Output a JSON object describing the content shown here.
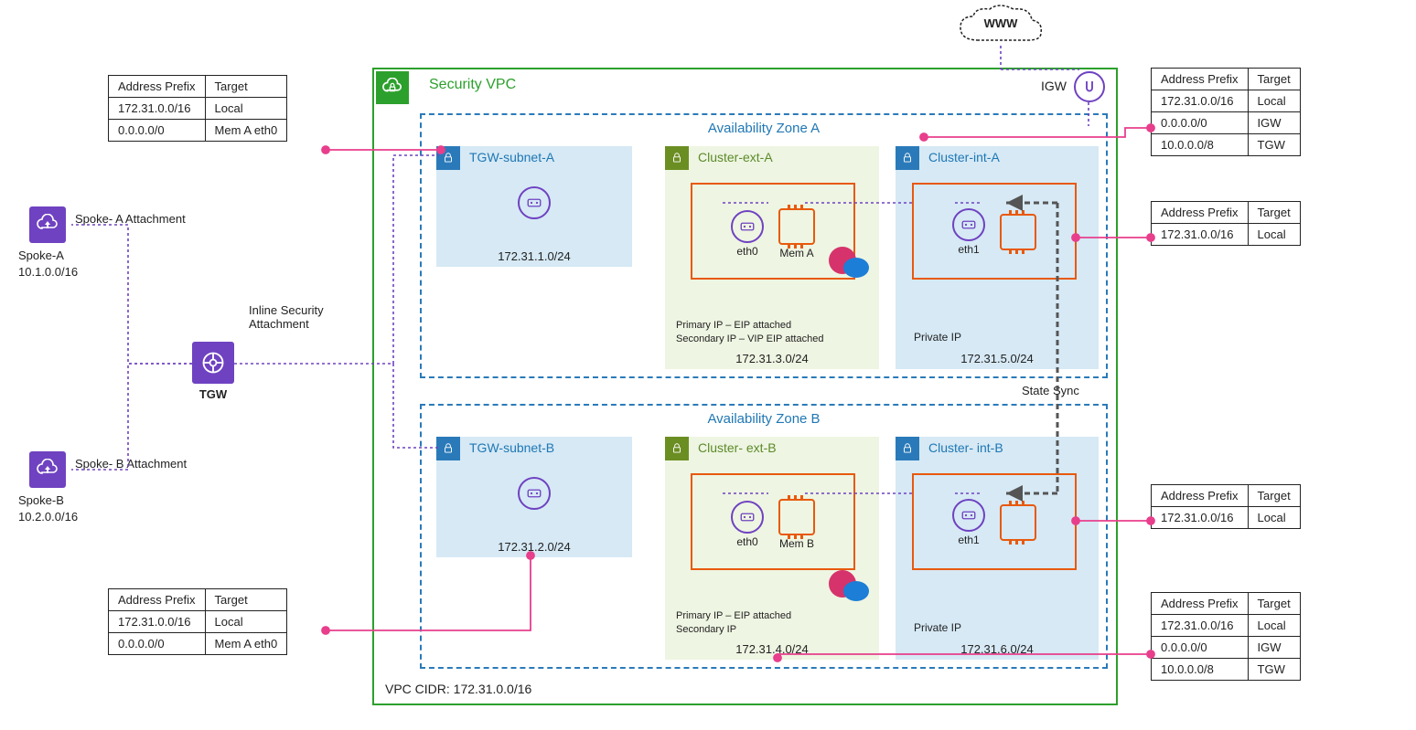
{
  "labels": {
    "www": "WWW",
    "igw": "IGW",
    "vpc_title": "Security VPC",
    "vpc_cidr": "VPC CIDR: 172.31.0.0/16",
    "tgw": "TGW",
    "inline_attach": "Inline Security Attachment",
    "state_sync": "State Sync",
    "az_a": "Availability Zone A",
    "az_b": "Availability Zone B"
  },
  "spokes": {
    "a": {
      "attach": "Spoke- A Attachment",
      "name": "Spoke-A",
      "cidr": "10.1.0.0/16"
    },
    "b": {
      "attach": "Spoke- B Attachment",
      "name": "Spoke-B",
      "cidr": "10.2.0.0/16"
    }
  },
  "subnets": {
    "tgw_a": {
      "label": "TGW-subnet-A",
      "cidr": "172.31.1.0/24"
    },
    "tgw_b": {
      "label": "TGW-subnet-B",
      "cidr": "172.31.2.0/24"
    },
    "ext_a": {
      "label": "Cluster-ext-A",
      "cidr": "172.31.3.0/24",
      "eth": "eth0",
      "mem": "Mem A",
      "caption": "Primary IP – EIP attached\nSecondary IP – VIP EIP attached"
    },
    "ext_b": {
      "label": "Cluster- ext-B",
      "cidr": "172.31.4.0/24",
      "eth": "eth0",
      "mem": "Mem B",
      "caption": "Primary IP – EIP attached\nSecondary IP"
    },
    "int_a": {
      "label": "Cluster-int-A",
      "cidr": "172.31.5.0/24",
      "eth": "eth1",
      "priv": "Private IP"
    },
    "int_b": {
      "label": "Cluster- int-B",
      "cidr": "172.31.6.0/24",
      "eth": "eth1",
      "priv": "Private IP"
    }
  },
  "tables": {
    "hdr_prefix": "Address Prefix",
    "hdr_target": "Target",
    "tgw_a_rt": [
      [
        "172.31.0.0/16",
        "Local"
      ],
      [
        "0.0.0.0/0",
        "Mem A eth0"
      ]
    ],
    "tgw_b_rt": [
      [
        "172.31.0.0/16",
        "Local"
      ],
      [
        "0.0.0.0/0",
        "Mem A eth0"
      ]
    ],
    "ext_a_rt": [
      [
        "172.31.0.0/16",
        "Local"
      ],
      [
        "0.0.0.0/0",
        "IGW"
      ],
      [
        "10.0.0.0/8",
        "TGW"
      ]
    ],
    "ext_b_rt": [
      [
        "172.31.0.0/16",
        "Local"
      ],
      [
        "0.0.0.0/0",
        "IGW"
      ],
      [
        "10.0.0.0/8",
        "TGW"
      ]
    ],
    "int_a_rt": [
      [
        "172.31.0.0/16",
        "Local"
      ]
    ],
    "int_b_rt": [
      [
        "172.31.0.0/16",
        "Local"
      ]
    ]
  }
}
